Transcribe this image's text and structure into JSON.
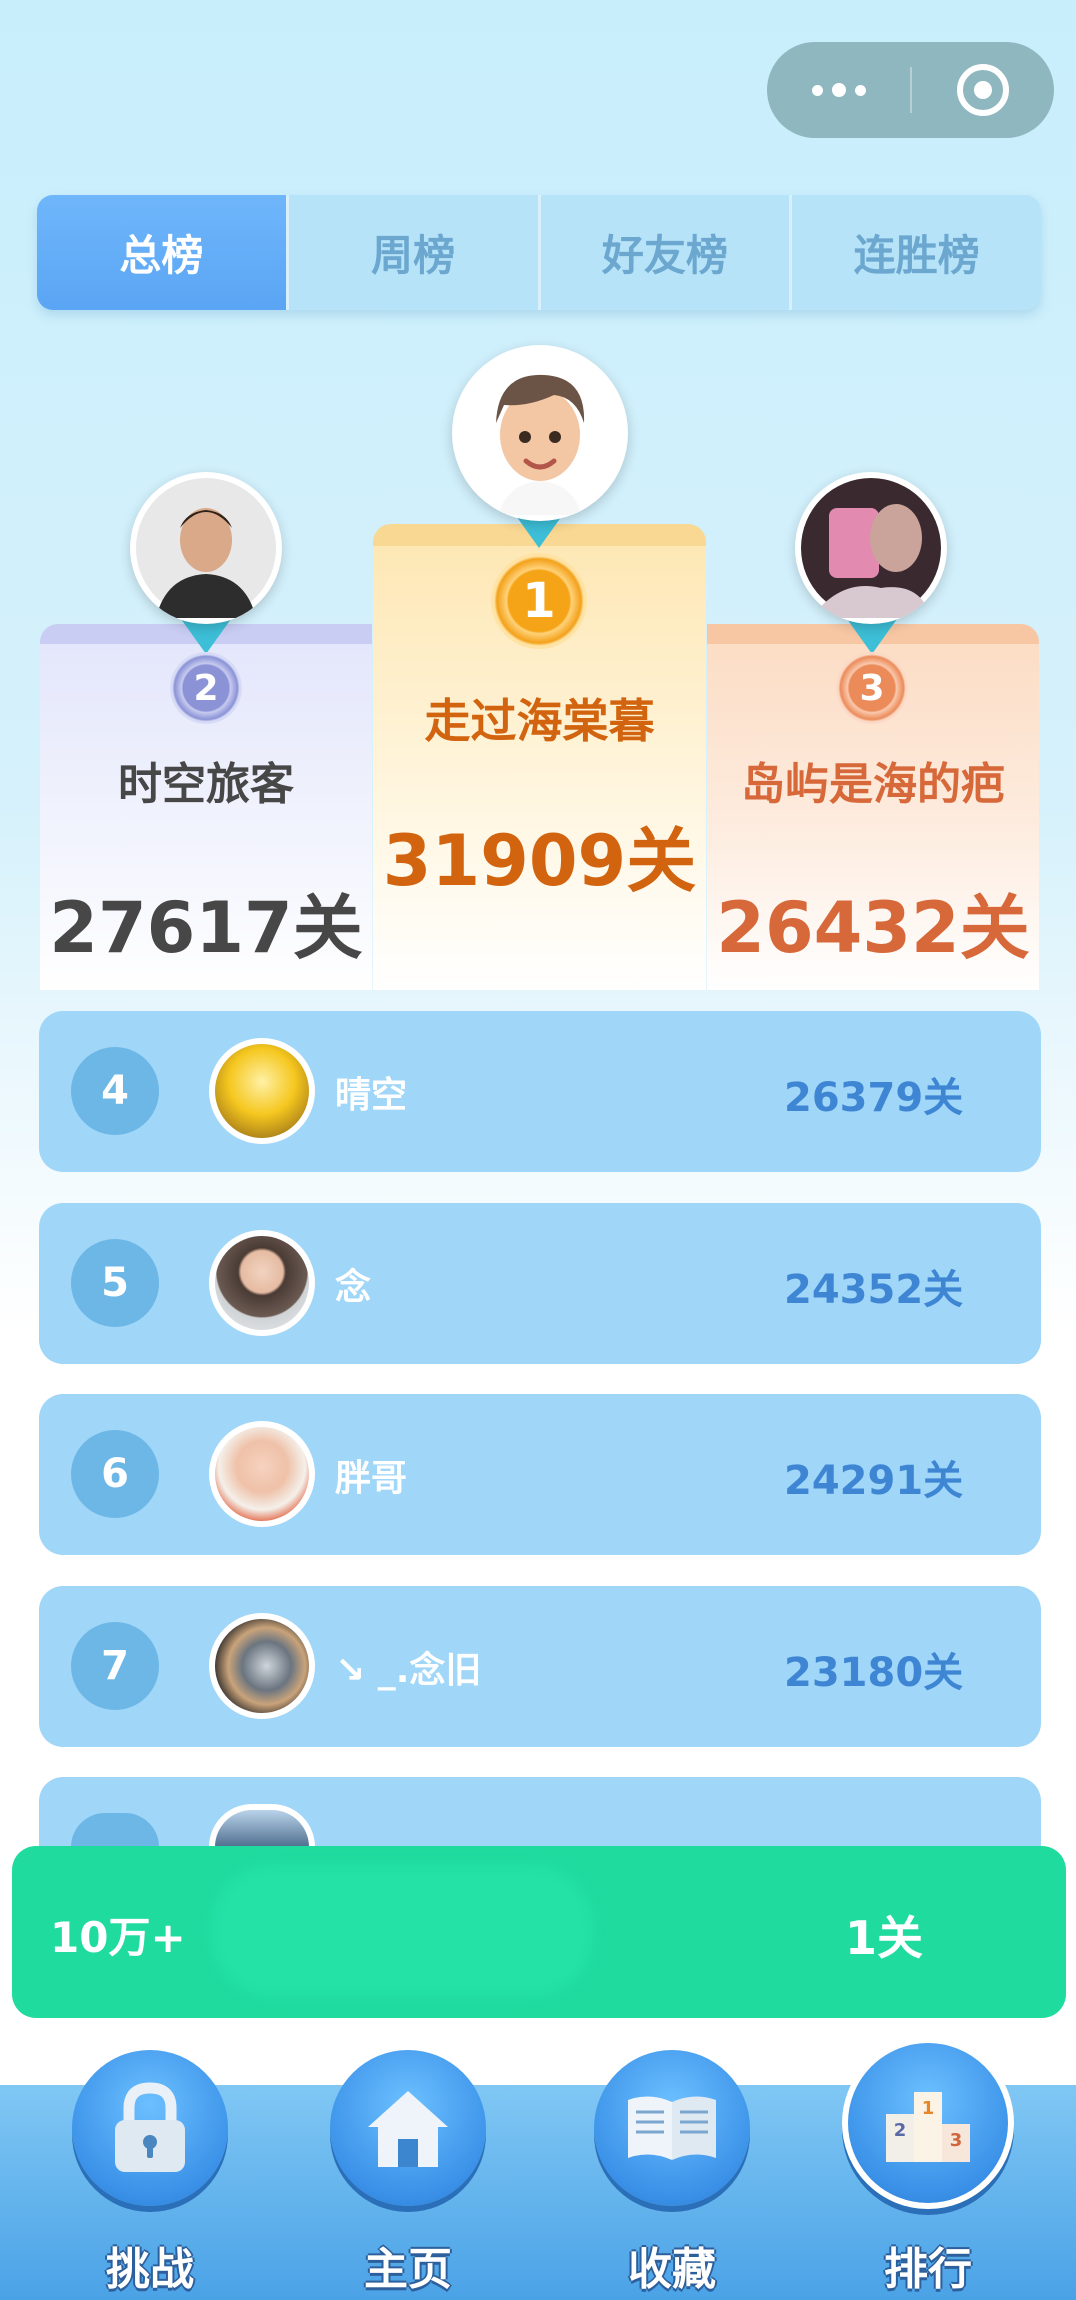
{
  "tabs": [
    "总榜",
    "周榜",
    "好友榜",
    "连胜榜"
  ],
  "active_tab": "总榜",
  "podium": {
    "first": {
      "rank": "1",
      "name": "走过海棠暮",
      "score": "31909关"
    },
    "second": {
      "rank": "2",
      "name": "时空旅客",
      "score": "27617关"
    },
    "third": {
      "rank": "3",
      "name": "岛屿是海的疤",
      "score": "26432关"
    }
  },
  "list": [
    {
      "rank": "4",
      "name": "晴空",
      "score": "26379关"
    },
    {
      "rank": "5",
      "name": "念",
      "score": "24352关"
    },
    {
      "rank": "6",
      "name": "胖哥",
      "score": "24291关"
    },
    {
      "rank": "7",
      "name": "↘ _.念旧",
      "score": "23180关"
    }
  ],
  "my_rank": {
    "rank": "10万+",
    "score": "1关"
  },
  "nav": {
    "challenge": "挑战",
    "home": "主页",
    "favorites": "收藏",
    "ranking": "排行"
  },
  "colors": {
    "accent": "#5aa5f4",
    "gold": "#d2640f",
    "silver_text": "#474747",
    "bronze": "#d7683a",
    "my_bar": "#1fdb9e",
    "row_bg": "#a0d6f8"
  }
}
